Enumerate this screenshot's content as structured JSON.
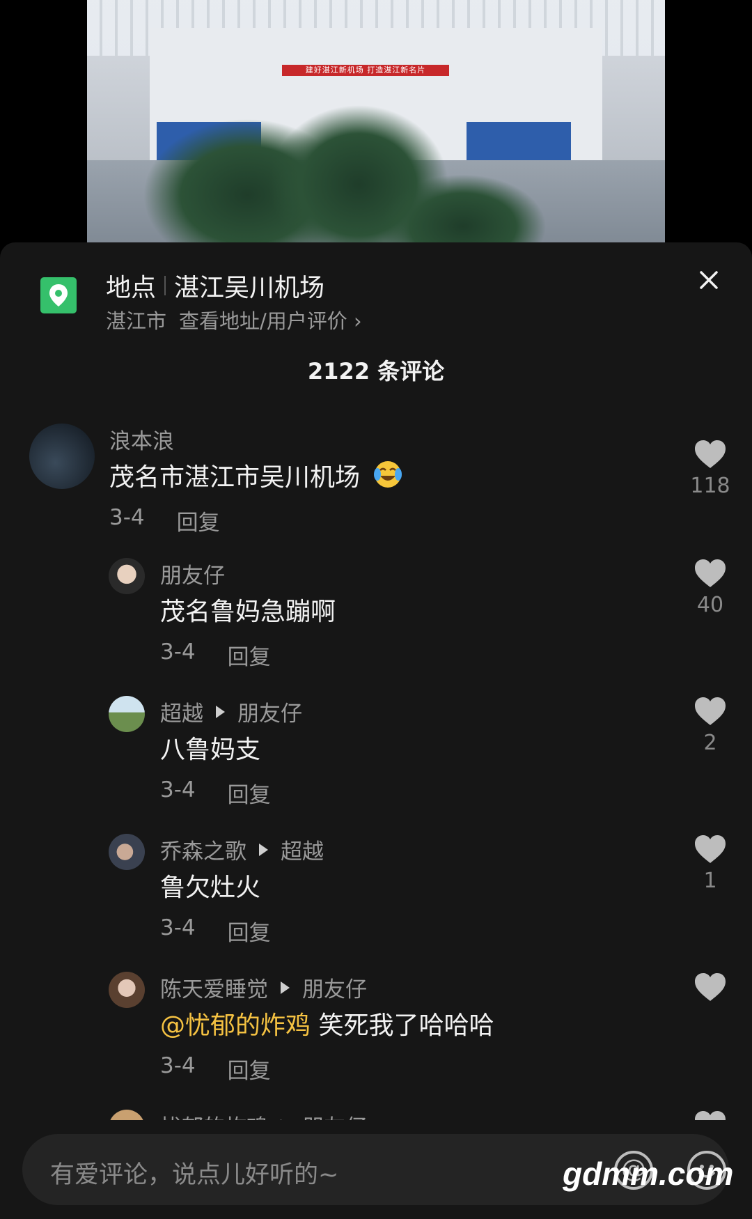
{
  "photo": {
    "banner": "建好湛江新机场 打造湛江新名片"
  },
  "location": {
    "label": "地点",
    "name": "湛江吴川机场",
    "city": "湛江市",
    "link": "查看地址/用户评价 ›"
  },
  "comments_count": "2122 条评论",
  "comments": [
    {
      "user": "浪本浪",
      "text": "茂名市湛江市吴川机场",
      "date": "3-4",
      "reply": "回复",
      "likes": "118"
    },
    {
      "user": "朋友仔",
      "text": "茂名鲁妈急蹦啊",
      "date": "3-4",
      "reply": "回复",
      "likes": "40"
    },
    {
      "user": "超越",
      "reply_to": "朋友仔",
      "text": "八鲁妈支",
      "date": "3-4",
      "reply": "回复",
      "likes": "2"
    },
    {
      "user": "乔森之歌",
      "reply_to": "超越",
      "text": "鲁欠灶火",
      "date": "3-4",
      "reply": "回复",
      "likes": "1"
    },
    {
      "user": "陈天爱睡觉",
      "reply_to": "朋友仔",
      "mention": "@忧郁的炸鸡",
      "text": " 笑死我了哈哈哈",
      "date": "3-4",
      "reply": "回复"
    },
    {
      "user": "忧郁的炸鸡",
      "reply_to": "朋友仔"
    }
  ],
  "input": {
    "placeholder": "有爱评论，说点儿好听的~"
  },
  "watermark": "gdmm.com",
  "colors": {
    "accent_green": "#35c06b",
    "mention": "#f5c242",
    "sheet_bg": "#161616"
  }
}
